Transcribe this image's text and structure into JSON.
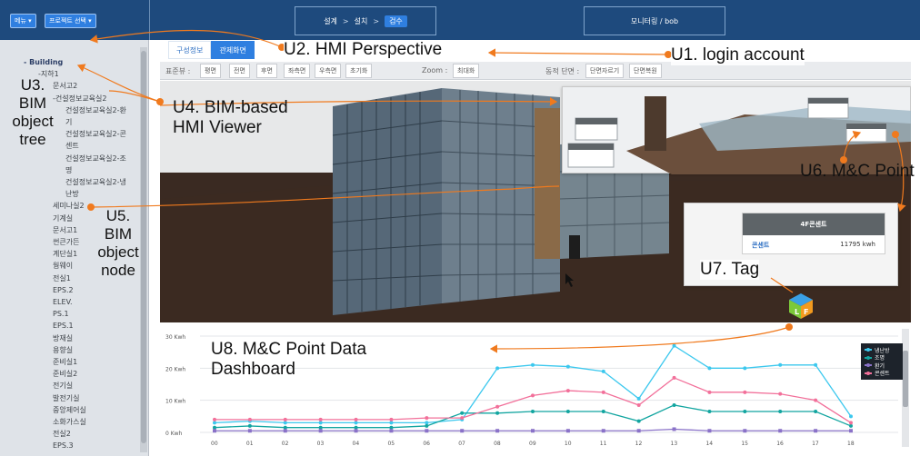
{
  "topbar": {
    "menu_label": "메뉴 ▾",
    "project_label": "프로젝트 선택 ▾",
    "steps": [
      "설계",
      "설치",
      "검수"
    ],
    "step_sep": ">",
    "user_label": "모니터링 / bob"
  },
  "tree": {
    "nodes": [
      {
        "label": "- Building",
        "bold": true
      },
      {
        "label": "-지하1"
      },
      {
        "label": "문서고2"
      },
      {
        "label": "-건설정보교육실2"
      },
      {
        "label": "건설정보교육실2-환"
      },
      {
        "label": "기"
      },
      {
        "label": "건설정보교육실2-콘"
      },
      {
        "label": "센트"
      },
      {
        "label": "건설정보교육실2-조"
      },
      {
        "label": "명"
      },
      {
        "label": "건설정보교육실2-냉"
      },
      {
        "label": "난방"
      },
      {
        "label": "세미나실2"
      },
      {
        "label": "기계실"
      },
      {
        "label": "문서고1"
      },
      {
        "label": "썬큰가든"
      },
      {
        "label": "계단실1"
      },
      {
        "label": "웜웨이"
      },
      {
        "label": "전실1"
      },
      {
        "label": "EPS.2"
      },
      {
        "label": "ELEV."
      },
      {
        "label": "PS.1"
      },
      {
        "label": "EPS.1"
      },
      {
        "label": "방재실"
      },
      {
        "label": "용향실"
      },
      {
        "label": "준비실1"
      },
      {
        "label": "준비실2"
      },
      {
        "label": "전기실"
      },
      {
        "label": "발전기실"
      },
      {
        "label": "중앙제어실"
      },
      {
        "label": "소화가스실"
      },
      {
        "label": "전실2"
      },
      {
        "label": "EPS.3"
      }
    ]
  },
  "tabs": [
    "구성정보",
    "관제화면"
  ],
  "toolbar": {
    "view_label": "표준뷰 :",
    "views": [
      "평면",
      "전면",
      "후면",
      "좌측면",
      "우측면",
      "초기화"
    ],
    "zoom_label": "Zoom :",
    "zoom_value": "최대화",
    "section_label": "동적 단면 :",
    "section_buttons": [
      "단면자르기",
      "단면복원"
    ]
  },
  "tag_card": {
    "title": "4F콘센트",
    "key": "콘센트",
    "value": "11795 kwh"
  },
  "annotations": {
    "u1": "U1. login account",
    "u2": "U2. HMI Perspective",
    "u3": "U3.\nBIM\nobject\ntree",
    "u4": "U4. BIM-based\nHMI Viewer",
    "u5": "U5.\nBIM\nobject\nnode",
    "u6": "U6. M&C Point",
    "u7": "U7. Tag",
    "u8": "U8. M&C Point Data\nDashboard",
    "logo_letters": "LF"
  },
  "colors": {
    "topbar": "#1e4a7d",
    "accent": "#2f7fe0",
    "series_cyan": "#3cc8ee",
    "series_teal": "#12a5a0",
    "series_purple": "#8a72c8",
    "series_pink": "#f2709a",
    "annotation_line": "#f07a1e"
  },
  "chart_data": {
    "type": "line",
    "categories": [
      "00",
      "01",
      "02",
      "03",
      "04",
      "05",
      "06",
      "07",
      "08",
      "09",
      "10",
      "11",
      "12",
      "13",
      "14",
      "15",
      "16",
      "17",
      "18"
    ],
    "y_tick_labels": [
      "0 Kwh",
      "10 Kwh",
      "20 Kwh",
      "30 Kwh"
    ],
    "ylim": [
      0,
      30
    ],
    "grid": true,
    "legend_position": "top-right",
    "series": [
      {
        "name": "냉난방",
        "color": "#3cc8ee",
        "values": [
          3,
          3.5,
          3,
          3,
          3,
          3,
          3,
          4,
          20,
          21,
          20.5,
          19,
          10.5,
          27,
          20,
          20,
          21,
          21,
          5
        ]
      },
      {
        "name": "조명",
        "color": "#12a5a0",
        "values": [
          1.5,
          2,
          1.5,
          1.5,
          1.5,
          1.5,
          2,
          6,
          6,
          6.5,
          6.5,
          6.5,
          3.5,
          8.5,
          6.5,
          6.5,
          6.5,
          6.5,
          2
        ]
      },
      {
        "name": "환기",
        "color": "#8a72c8",
        "values": [
          0.5,
          0.5,
          0.5,
          0.5,
          0.5,
          0.5,
          0.5,
          0.5,
          0.5,
          0.5,
          0.5,
          0.5,
          0.5,
          1,
          0.5,
          0.5,
          0.5,
          0.5,
          0.5
        ]
      },
      {
        "name": "콘센트",
        "color": "#f2709a",
        "values": [
          4,
          4,
          4,
          4,
          4,
          4,
          4.5,
          4.5,
          8,
          11.5,
          13,
          12.5,
          8.5,
          17,
          12.5,
          12.5,
          12,
          10,
          3
        ]
      }
    ]
  }
}
